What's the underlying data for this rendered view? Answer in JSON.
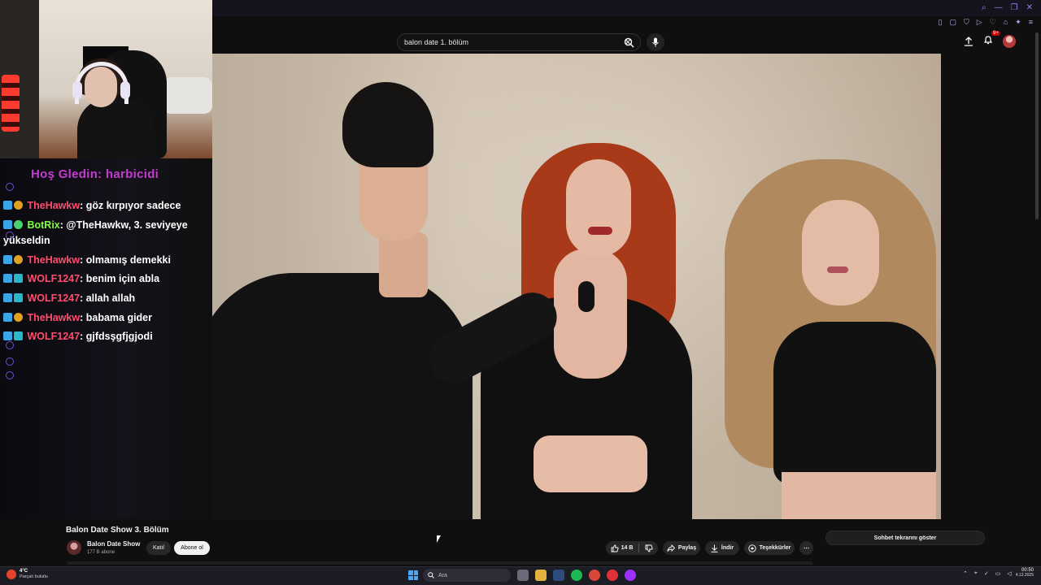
{
  "search": {
    "query": "balon date 1. bölüm"
  },
  "header": {
    "notification_count": "9+"
  },
  "chat": {
    "welcome": "Hoş Gledin: harbicidi",
    "messages": [
      {
        "user": "TheHawkw",
        "text": ": göz kırpıyor sadece",
        "user_color": "#ff4d6d"
      },
      {
        "user": "BotRix",
        "text": ": @TheHawkw, 3. seviyeye",
        "cont": "yükseldin",
        "user_color": "#7cff3f"
      },
      {
        "user": "TheHawkw",
        "text": ": olmamış demekki",
        "user_color": "#ff4d6d"
      },
      {
        "user": "WOLF1247",
        "text": ": benim için abla",
        "user_color": "#ff4d6d"
      },
      {
        "user": "WOLF1247",
        "text": ": allah allah",
        "user_color": "#ff4d6d"
      },
      {
        "user": "TheHawkw",
        "text": ": babama gider",
        "user_color": "#ff4d6d"
      },
      {
        "user": "WOLF1247",
        "text": ": gjfdsşgfjgjodi",
        "user_color": "#ff4d6d"
      }
    ]
  },
  "video": {
    "title": "Balon Date Show 3. Bölüm",
    "channel": "Balon Date Show",
    "subscribers": "177 B abone",
    "join_label": "Katıl",
    "subscribe_label": "Abone ol",
    "likes": "14 B",
    "share_label": "Paylaş",
    "download_label": "İndir",
    "thanks_label": "Teşekkürler",
    "more_label": "⋯"
  },
  "sidebar": {
    "chat_replay_label": "Sohbet tekrarını göster"
  },
  "taskbar": {
    "weather_temp": "4°C",
    "weather_desc": "Parçalı bulutlu",
    "search_placeholder": "Ara",
    "time": "00:50",
    "date": "4.12.2025"
  },
  "colors": {
    "accent": "#9a7ff0",
    "welcome": "#c43bd2",
    "youtube_red": "#cc0000"
  }
}
